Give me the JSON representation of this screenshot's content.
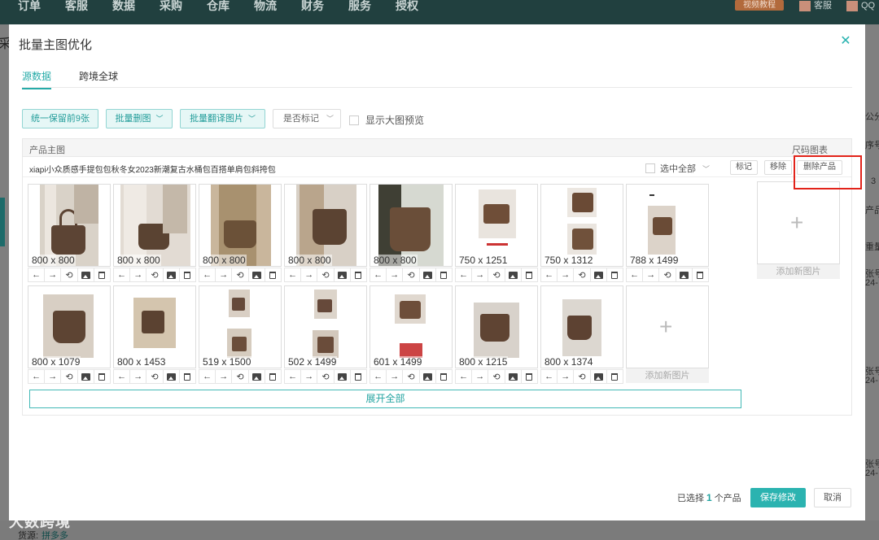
{
  "topnav": {
    "menu": [
      "订单",
      "客服",
      "数据",
      "采购",
      "仓库",
      "物流",
      "财务",
      "服务",
      "授权"
    ],
    "tutorial": "视频教程",
    "kefu": "客服",
    "qq": "QQ"
  },
  "background": {
    "right_texts": [
      "公分",
      "序号",
      "3",
      "产品",
      "重量人",
      "张号",
      "24-",
      "张号",
      "24-",
      "张号",
      "24-"
    ],
    "left_text": "采",
    "source_label": "货源:",
    "source_value": "拼多多",
    "watermark": "大数跨境"
  },
  "modal": {
    "title": "批量主图优化",
    "tabs": [
      {
        "label": "源数据",
        "active": true
      },
      {
        "label": "跨境全球",
        "active": false
      }
    ],
    "toolbar": {
      "keep9": "统一保留前9张",
      "batch_delete": "批量删图",
      "batch_translate": "批量翻译图片",
      "mark_select": "是否标记",
      "show_large": "显示大图预览"
    },
    "table": {
      "col_main": "产品主图",
      "col_size": "尺码图表",
      "product_name": "xiapi小众质感手提包包秋冬女2023新潮复古水桶包百搭单肩包斜挎包",
      "select_all": "选中全部",
      "mark": "标记",
      "remove": "移除",
      "delete_product": "删除产品"
    },
    "images": [
      {
        "size": "800 x 800"
      },
      {
        "size": "800 x 800"
      },
      {
        "size": "800 x 800"
      },
      {
        "size": "800 x 800"
      },
      {
        "size": "800 x 800"
      },
      {
        "size": "750 x 1251"
      },
      {
        "size": "750 x 1312"
      },
      {
        "size": "788 x 1499"
      },
      {
        "size": "800 x 1079"
      },
      {
        "size": "800 x 1453"
      },
      {
        "size": "519 x 1500"
      },
      {
        "size": "502 x 1499"
      },
      {
        "size": "601 x 1499"
      },
      {
        "size": "800 x 1215"
      },
      {
        "size": "800 x 1374"
      }
    ],
    "add_image": "添加新图片",
    "expand_all": "展开全部",
    "footer": {
      "selected_prefix": "已选择",
      "selected_count": "1",
      "selected_suffix": "个产品",
      "save": "保存修改",
      "cancel": "取消"
    }
  }
}
